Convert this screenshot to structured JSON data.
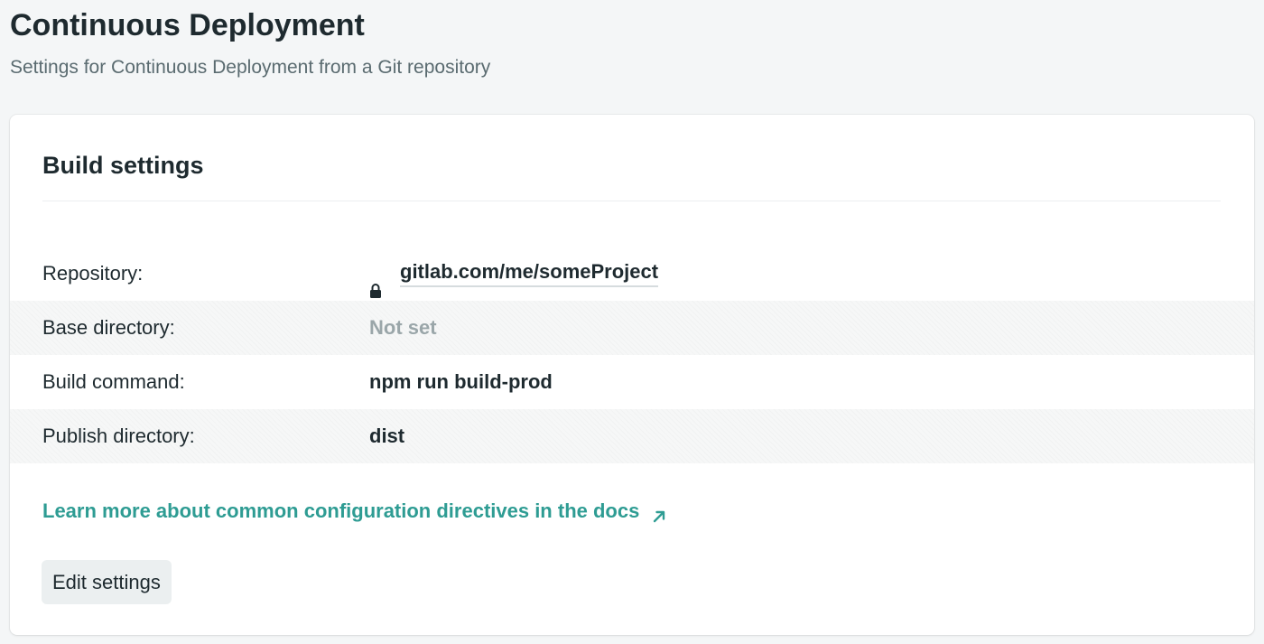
{
  "header": {
    "title": "Continuous Deployment",
    "subtitle": "Settings for Continuous Deployment from a Git repository"
  },
  "card": {
    "title": "Build settings",
    "rows": [
      {
        "label": "Repository:",
        "value": "gitlab.com/me/someProject",
        "icon": "lock-icon"
      },
      {
        "label": "Base directory:",
        "value": "Not set"
      },
      {
        "label": "Build command:",
        "value": "npm run build-prod"
      },
      {
        "label": "Publish directory:",
        "value": "dist"
      }
    ],
    "docs_link": {
      "label": "Learn more about common configuration directives in the docs",
      "icon": "external-arrow-icon"
    },
    "edit_button": "Edit settings"
  },
  "colors": {
    "background": "#f4f6f7",
    "accent_link": "#2e9c93",
    "muted_value": "#9aa6a9"
  }
}
